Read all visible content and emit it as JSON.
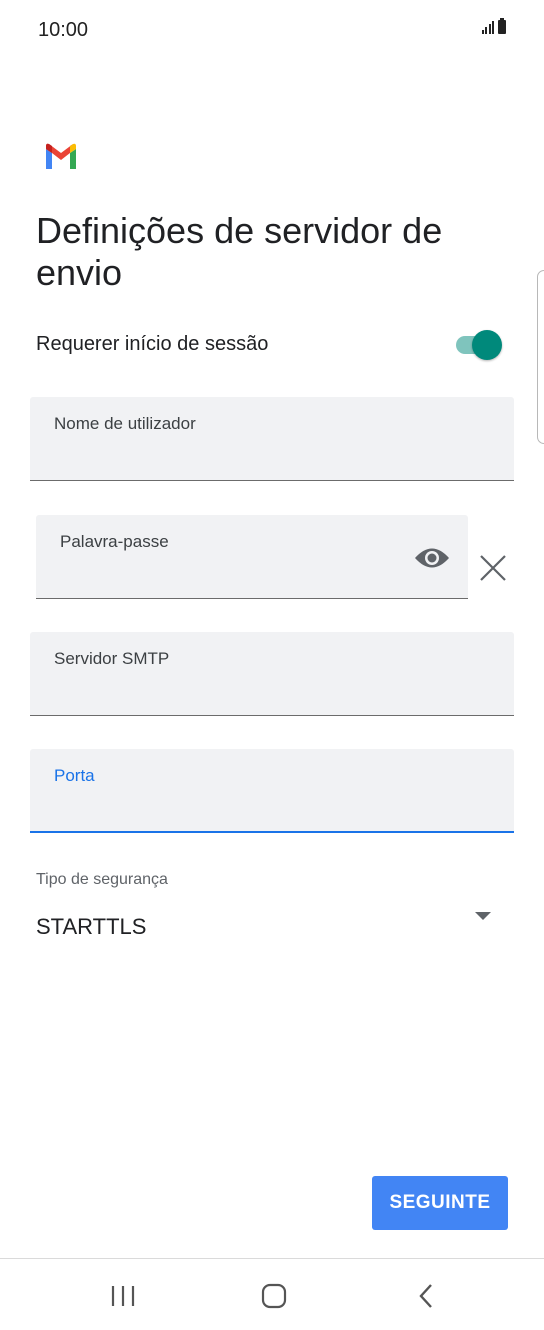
{
  "status_bar": {
    "time": "10:00"
  },
  "title": "Definições de servidor de envio",
  "require_signin": {
    "label": "Requerer início de sessão",
    "enabled": true
  },
  "fields": {
    "username": {
      "label": "Nome de utilizador",
      "value": ""
    },
    "password": {
      "label": "Palavra-passe",
      "value": ""
    },
    "smtp_server": {
      "label": "Servidor SMTP",
      "value": ""
    },
    "port": {
      "label": "Porta",
      "value": ""
    }
  },
  "security": {
    "label": "Tipo de segurança",
    "selected": "STARTTLS"
  },
  "next_button": {
    "label": "SEGUINTE"
  },
  "colors": {
    "accent": "#4285f4",
    "focus": "#1a73e8",
    "toggle_on": "#00897b",
    "field_bg": "#f1f2f4"
  },
  "icons": [
    "gmail-logo",
    "eye-icon",
    "close-icon",
    "dropdown-arrow-icon",
    "recent-apps-icon",
    "home-icon",
    "back-icon"
  ]
}
